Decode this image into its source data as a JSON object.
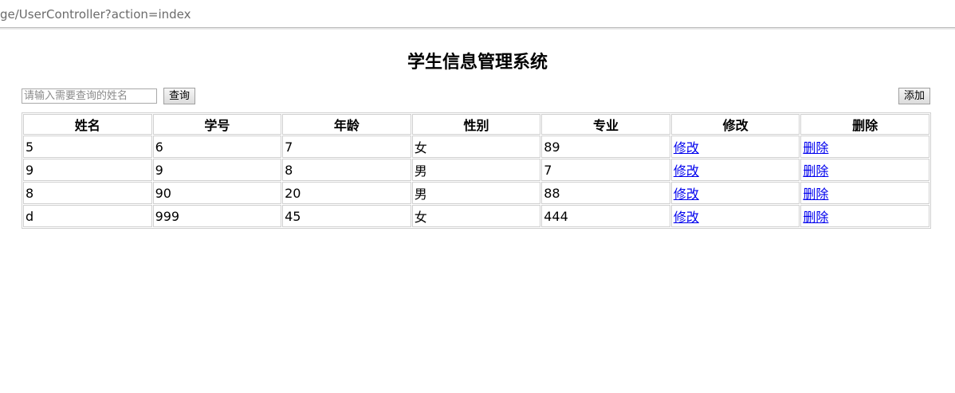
{
  "browser": {
    "url": "ge/UserController?action=index"
  },
  "page": {
    "title": "学生信息管理系统"
  },
  "search": {
    "placeholder": "请输入需要查询的姓名",
    "value": "",
    "button_label": "查询"
  },
  "toolbar": {
    "add_label": "添加"
  },
  "table": {
    "headers": [
      "姓名",
      "学号",
      "年龄",
      "性别",
      "专业",
      "修改",
      "删除"
    ],
    "rows": [
      {
        "name": "5",
        "id": "6",
        "age": "7",
        "gender": "女",
        "major": "89",
        "edit": "修改",
        "delete": "删除"
      },
      {
        "name": "9",
        "id": "9",
        "age": "8",
        "gender": "男",
        "major": "7",
        "edit": "修改",
        "delete": "删除"
      },
      {
        "name": "8",
        "id": "90",
        "age": "20",
        "gender": "男",
        "major": "88",
        "edit": "修改",
        "delete": "删除"
      },
      {
        "name": "d",
        "id": "999",
        "age": "45",
        "gender": "女",
        "major": "444",
        "edit": "修改",
        "delete": "删除"
      }
    ]
  },
  "colors": {
    "link": "#0000ee",
    "border": "#d0d0d0"
  }
}
